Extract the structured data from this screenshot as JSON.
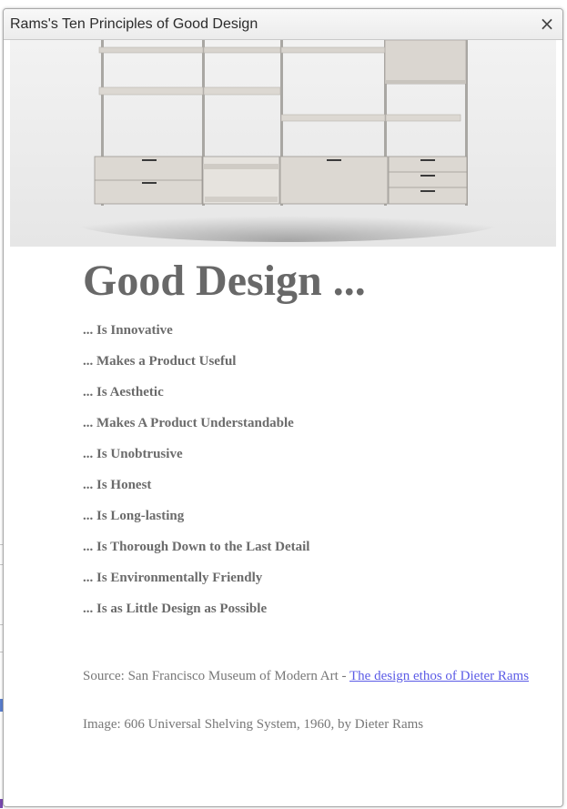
{
  "dialog": {
    "title": "Rams's Ten Principles of Good Design",
    "close_glyph": "×"
  },
  "hero_image": {
    "icon": "shelving-system-photo",
    "colors": {
      "wall": "#eeeeee",
      "shelf": "#d6d2cc",
      "rail": "#a9a7a3"
    }
  },
  "article": {
    "heading": "Good Design ...",
    "principles": [
      "... Is Innovative",
      "... Makes a Product Useful",
      "... Is Aesthetic",
      "... Makes A Product Understandable",
      "... Is Unobtrusive",
      "... Is Honest",
      "... Is Long-lasting",
      "... Is Thorough Down to the Last Detail",
      "... Is Environmentally Friendly",
      "... Is as Little Design as Possible"
    ],
    "source_prefix": "Source: San Francisco Museum of Modern Art - ",
    "source_link": "The design ethos of Dieter Rams",
    "image_credit": "Image: 606 Universal Shelving System, 1960, by Dieter Rams"
  },
  "colors": {
    "text": "#666666",
    "link": "#5b5be6",
    "titlebar": "#efefef"
  }
}
